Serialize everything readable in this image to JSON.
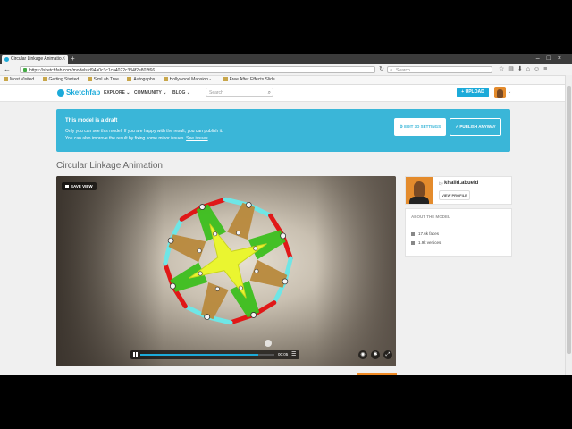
{
  "browser": {
    "tab_title": "Circular Linkage Animatio...",
    "new_tab": "+",
    "window_controls": "–□×",
    "back": "←",
    "url": "https://sketchfab.com/models/d94a0c3c1ca4022c334f2e802f66",
    "reload": "↻",
    "search_placeholder": "Search",
    "bookmarks": [
      "Most Visited",
      "Getting Started",
      "SimLab Tree",
      "Autogaphs",
      "Hollywood Mansion -...",
      "Free After Effects Slide..."
    ]
  },
  "header": {
    "logo": "Sketchfab",
    "menu": [
      "EXPLORE",
      "COMMUNITY",
      "BLOG"
    ],
    "search_placeholder": "Search",
    "upload_label": "UPLOAD"
  },
  "draft": {
    "title": "This model is a draft",
    "line1": "Only you can see this model. If you are happy with the result, you can publish it.",
    "line2": "You can also improve the result by fixing some minor issues. ",
    "link": "See issues",
    "edit_label": "EDIT 3D SETTINGS",
    "publish_label": "PUBLISH ANYWAY"
  },
  "model": {
    "title": "Circular Linkage Animation",
    "save_view": "SAVE VIEW",
    "time": "00:05",
    "progress": 0.88
  },
  "author": {
    "by": "by",
    "name": "khalid.abueid",
    "view_profile": "VIEW PROFILE"
  },
  "about": {
    "heading": "ABOUT THE MODEL",
    "faces": "17.6k faces",
    "vertices": "1.9k vertices"
  },
  "colors": {
    "accent": "#1caad9",
    "draft_bg": "#3ab6d8",
    "center_yellow": "#eaf530",
    "green": "#3cbf1e",
    "brown": "#b8893c",
    "red": "#e01818",
    "cyan": "#6ee6e6"
  }
}
